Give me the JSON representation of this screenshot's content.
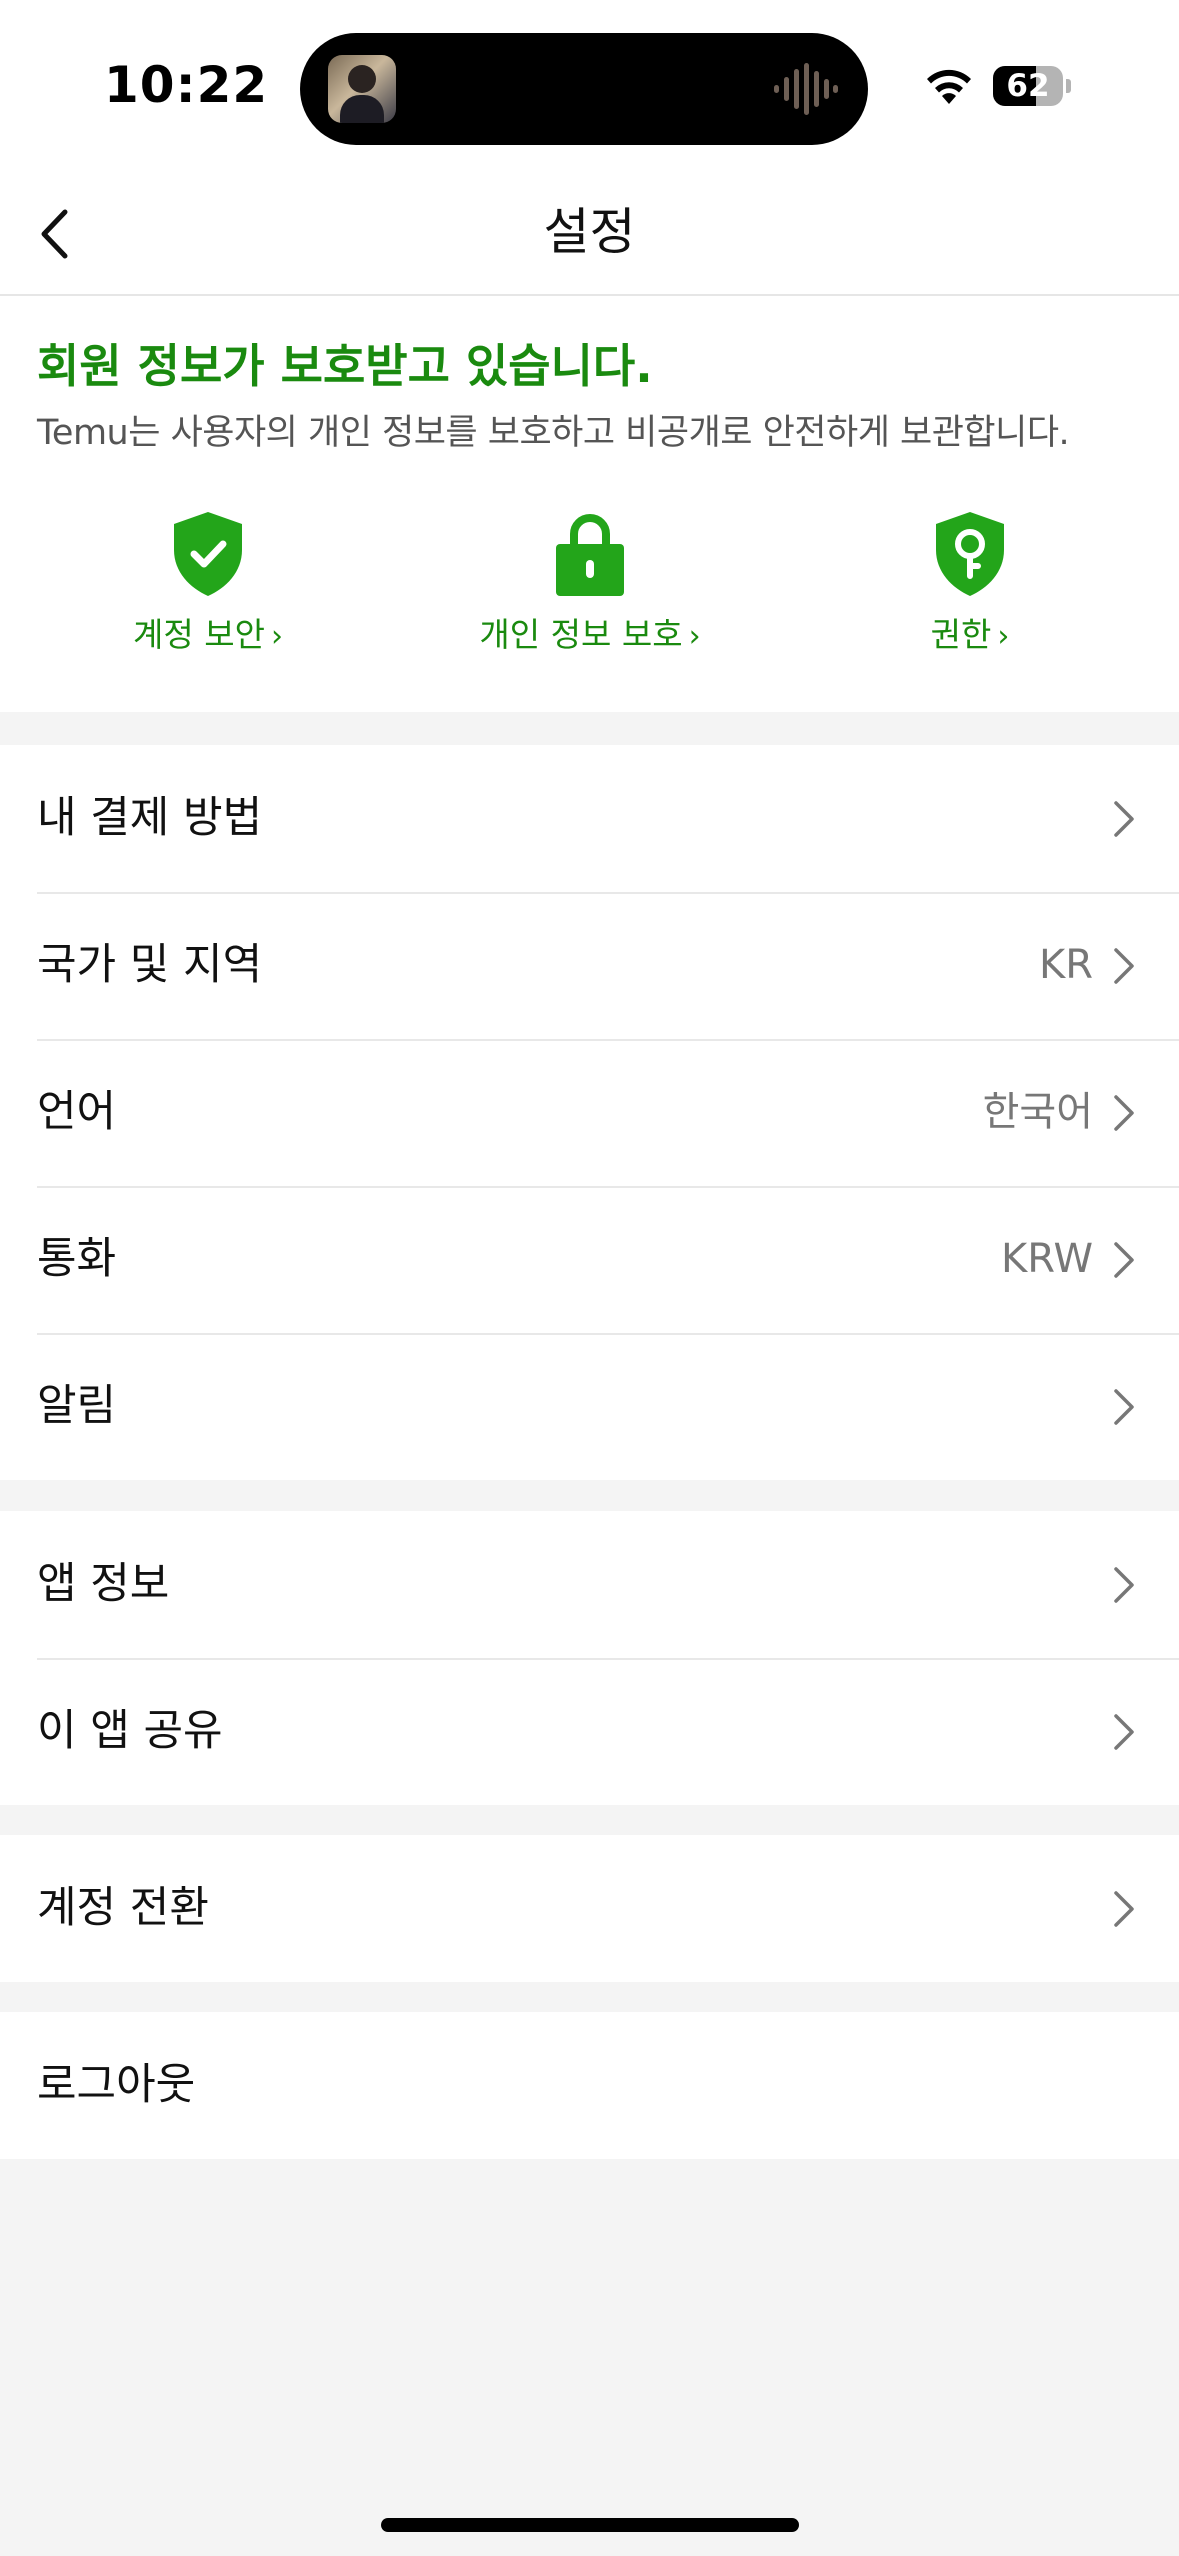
{
  "status_bar": {
    "time": "10:22",
    "battery": "62",
    "battery_level": 0.62
  },
  "nav": {
    "title": "설정"
  },
  "protection": {
    "title": "회원 정보가 보호받고 있습니다.",
    "description": "Temu는 사용자의 개인 정보를 보호하고 비공개로 안전하게 보관합니다.",
    "features": [
      {
        "label": "계정 보안",
        "icon": "shield-check-icon"
      },
      {
        "label": "개인 정보 보호",
        "icon": "lock-icon"
      },
      {
        "label": "권한",
        "icon": "shield-key-icon"
      }
    ],
    "accent_color": "#1a8a0f",
    "icon_color": "#23a51a"
  },
  "settings": {
    "group1": [
      {
        "label": "내 결제 방법",
        "value": ""
      },
      {
        "label": "국가 및 지역",
        "value": "KR"
      },
      {
        "label": "언어",
        "value": "한국어"
      },
      {
        "label": "통화",
        "value": "KRW"
      },
      {
        "label": "알림",
        "value": ""
      }
    ],
    "group2": [
      {
        "label": "앱 정보",
        "value": ""
      },
      {
        "label": "이 앱 공유",
        "value": ""
      }
    ],
    "group3": [
      {
        "label": "계정 전환",
        "value": ""
      }
    ],
    "group4": [
      {
        "label": "로그아웃",
        "value": ""
      }
    ]
  }
}
